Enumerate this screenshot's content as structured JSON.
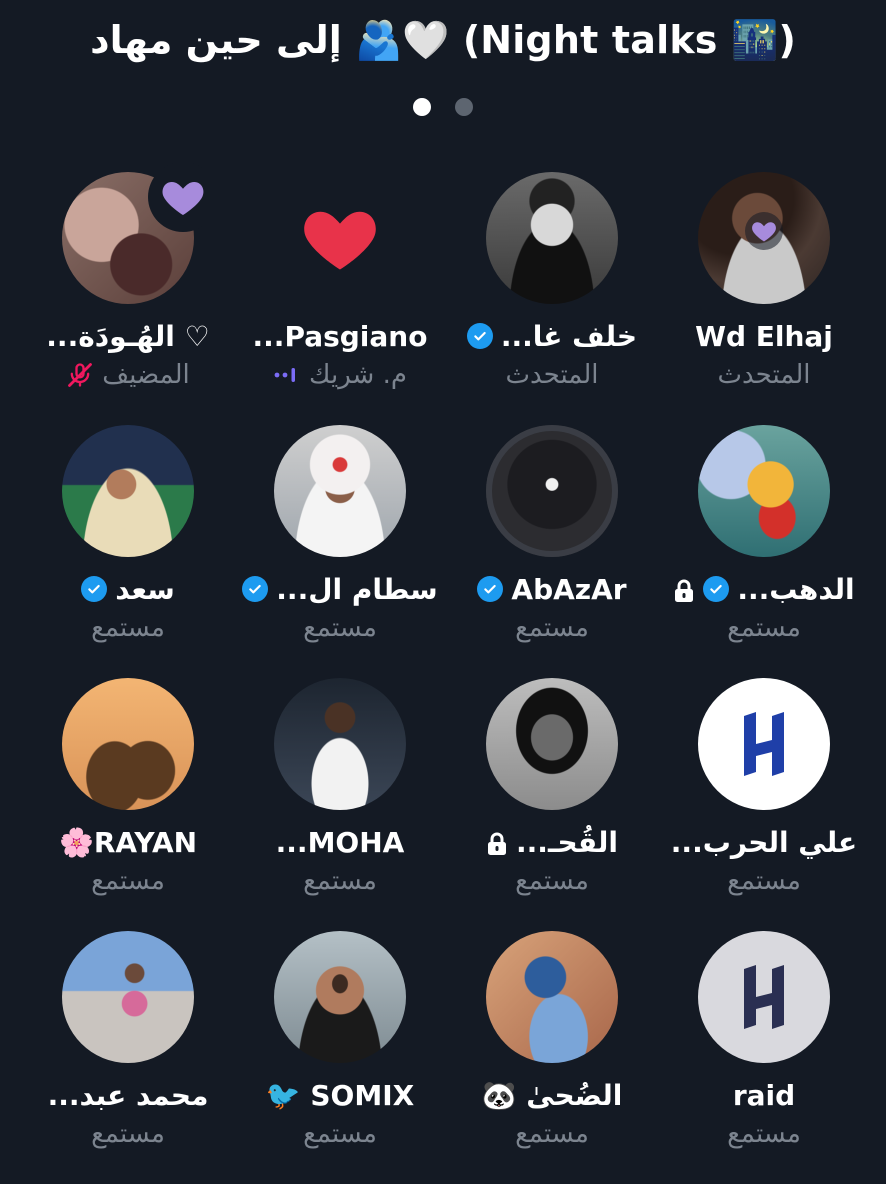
{
  "space": {
    "title": "إلى حين مهاد 🫂🤍 (Night talks 🌃)",
    "pages": 2,
    "current_page": 1
  },
  "colors": {
    "background": "#141a24",
    "verified": "#1d9bf0",
    "reaction_purple": "#a78bdc",
    "reaction_red": "#e8334a",
    "muted_pink": "#f0185e",
    "speaking_purple": "#7b6cf6"
  },
  "participants": [
    {
      "name": "Wd Elhaj",
      "role": "المتحدث",
      "verified": false,
      "locked": false,
      "avatar": "photo-person-glasses",
      "reaction": "purple-heart-small"
    },
    {
      "name": "خلف غا...",
      "role": "المتحدث",
      "verified": true,
      "locked": false,
      "avatar": "photo-man-bw",
      "reaction": ""
    },
    {
      "name": "Pasgiano...",
      "role": "م. شريك",
      "verified": false,
      "locked": false,
      "avatar": "reaction-red-heart",
      "reaction": "red-heart",
      "role_icon": "speaking-bars-icon"
    },
    {
      "name": "♡ الهُـودَة...",
      "role": "المضيف",
      "verified": false,
      "locked": false,
      "avatar": "photo-blurred",
      "reaction": "purple-heart",
      "role_icon": "mic-muted-icon"
    },
    {
      "name": "الدهب...",
      "role": "مستمع",
      "verified": true,
      "locked": true,
      "avatar": "winnie-the-pooh",
      "reaction": ""
    },
    {
      "name": "AbAzAr",
      "role": "مستمع",
      "verified": true,
      "locked": false,
      "avatar": "loading-screen",
      "reaction": ""
    },
    {
      "name": "سطام ال...",
      "role": "مستمع",
      "verified": true,
      "locked": false,
      "avatar": "photo-man-shemagh",
      "reaction": ""
    },
    {
      "name": "سعد",
      "role": "مستمع",
      "verified": true,
      "locked": false,
      "avatar": "photo-man-stadium",
      "reaction": ""
    },
    {
      "name": "علي الحرب...",
      "role": "مستمع",
      "verified": false,
      "locked": false,
      "avatar": "al-hilal-logo-white",
      "reaction": ""
    },
    {
      "name": "القُحـ...",
      "role": "مستمع",
      "verified": false,
      "locked": true,
      "avatar": "photo-woman-bw",
      "reaction": ""
    },
    {
      "name": "MOHA...",
      "role": "مستمع",
      "verified": false,
      "locked": false,
      "avatar": "photo-man-white-shirt",
      "reaction": ""
    },
    {
      "name": "RAYAN🌸",
      "role": "مستمع",
      "verified": false,
      "locked": false,
      "avatar": "silhouette-orange",
      "reaction": ""
    },
    {
      "name": "raid",
      "role": "مستمع",
      "verified": false,
      "locked": false,
      "avatar": "al-hilal-logo-grey",
      "reaction": ""
    },
    {
      "name": "الضُحىٰ 🐼",
      "role": "مستمع",
      "verified": false,
      "locked": false,
      "avatar": "painting-reading",
      "reaction": ""
    },
    {
      "name": "SOMIX 🐦",
      "role": "مستمع",
      "verified": false,
      "locked": false,
      "avatar": "photo-man-sunglasses",
      "reaction": ""
    },
    {
      "name": "محمد عبد...",
      "role": "مستمع",
      "verified": false,
      "locked": false,
      "avatar": "photo-man-beach",
      "reaction": ""
    }
  ]
}
